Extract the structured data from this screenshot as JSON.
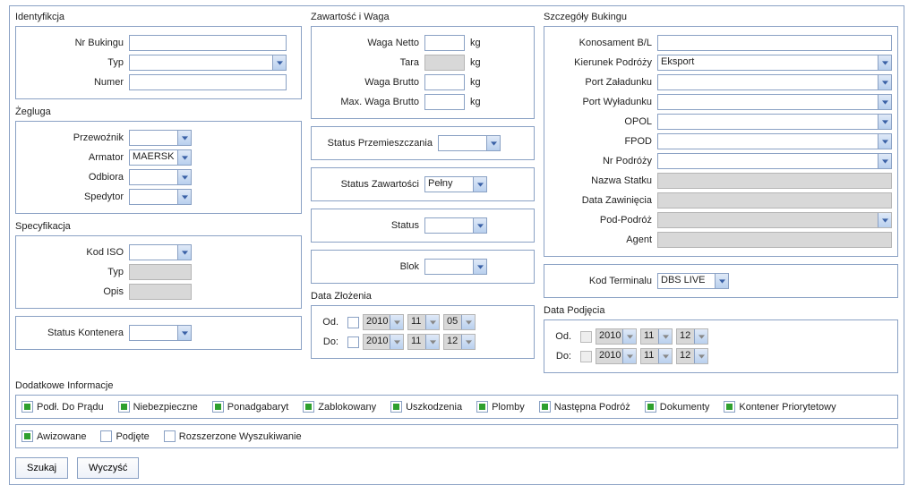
{
  "identyfikacja": {
    "title": "Identyfikcja",
    "nrBukingu": {
      "label": "Nr Bukingu",
      "value": ""
    },
    "typ": {
      "label": "Typ",
      "value": ""
    },
    "numer": {
      "label": "Numer",
      "value": ""
    }
  },
  "zegluga": {
    "title": "Żegluga",
    "przewoznik": {
      "label": "Przewoźnik",
      "value": ""
    },
    "armator": {
      "label": "Armator",
      "value": "MAERSK"
    },
    "odbiora": {
      "label": "Odbiora",
      "value": ""
    },
    "spedytor": {
      "label": "Spedytor",
      "value": ""
    }
  },
  "specyfikacja": {
    "title": "Specyfikacja",
    "kodISO": {
      "label": "Kod ISO",
      "value": ""
    },
    "typ": {
      "label": "Typ",
      "value": ""
    },
    "opis": {
      "label": "Opis",
      "value": ""
    }
  },
  "statusKontenera": {
    "label": "Status Kontenera",
    "value": ""
  },
  "zawartosc": {
    "title": "Zawartość i Waga",
    "wagaNetto": {
      "label": "Waga Netto",
      "value": "",
      "unit": "kg"
    },
    "tara": {
      "label": "Tara",
      "value": "",
      "unit": "kg"
    },
    "wagaBrutto": {
      "label": "Waga Brutto",
      "value": "",
      "unit": "kg"
    },
    "maxWaga": {
      "label": "Max. Waga Brutto",
      "value": "",
      "unit": "kg"
    },
    "statusPrzemieszczania": {
      "label": "Status Przemieszczania",
      "value": ""
    },
    "statusZawartosci": {
      "label": "Status Zawartości",
      "value": "Pełny"
    },
    "status": {
      "label": "Status",
      "value": ""
    },
    "blok": {
      "label": "Blok",
      "value": ""
    }
  },
  "dataZlozenia": {
    "title": "Data Złożenia",
    "odLabel": "Od.",
    "doLabel": "Do:",
    "od": {
      "year": "2010",
      "month": "11",
      "day": "05"
    },
    "do": {
      "year": "2010",
      "month": "11",
      "day": "12"
    }
  },
  "bukingu": {
    "title": "Szczegóły Bukingu",
    "konosament": {
      "label": "Konosament B/L",
      "value": ""
    },
    "kierunek": {
      "label": "Kierunek Podróży",
      "value": "Eksport"
    },
    "portZaladunku": {
      "label": "Port Załadunku",
      "value": ""
    },
    "portWyladunku": {
      "label": "Port Wyładunku",
      "value": ""
    },
    "opol": {
      "label": "OPOL",
      "value": ""
    },
    "fpod": {
      "label": "FPOD",
      "value": ""
    },
    "nrPodrozy": {
      "label": "Nr Podróży",
      "value": ""
    },
    "nazwaStatku": {
      "label": "Nazwa Statku",
      "value": ""
    },
    "dataZawiniecia": {
      "label": "Data Zawinięcia",
      "value": ""
    },
    "podPodroz": {
      "label": "Pod-Podróż",
      "value": ""
    },
    "agent": {
      "label": "Agent",
      "value": ""
    }
  },
  "kodTerminalu": {
    "label": "Kod Terminalu",
    "value": "DBS LIVE"
  },
  "dataPodjecia": {
    "title": "Data Podjęcia",
    "odLabel": "Od.",
    "doLabel": "Do:",
    "od": {
      "year": "2010",
      "month": "11",
      "day": "12"
    },
    "do": {
      "year": "2010",
      "month": "11",
      "day": "12"
    }
  },
  "dodatkowe": {
    "title": "Dodatkowe Informacje",
    "flags1": {
      "podDoPradu": "Podł. Do Prądu",
      "niebezpieczne": "Niebezpieczne",
      "ponadgabaryt": "Ponadgabaryt",
      "zablokowany": "Zablokowany",
      "uszkodzenia": "Uszkodzenia",
      "plomby": "Plomby",
      "nastepna": "Następna Podróż",
      "dokumenty": "Dokumenty",
      "priorytet": "Kontener Priorytetowy"
    },
    "flags2": {
      "awizowane": "Awizowane",
      "podjete": "Podjęte",
      "rozszerzone": "Rozszerzone Wyszukiwanie"
    }
  },
  "buttons": {
    "szukaj": "Szukaj",
    "wyczysc": "Wyczyść"
  }
}
